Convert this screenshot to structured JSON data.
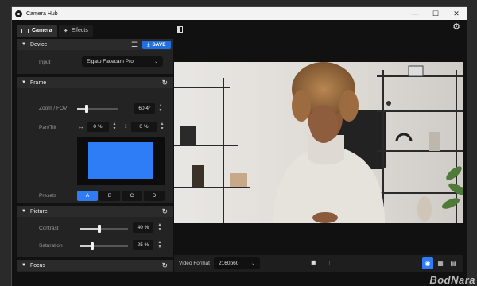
{
  "window": {
    "title": "Camera Hub"
  },
  "tabs": [
    {
      "label": "Camera",
      "icon": "camera-icon"
    },
    {
      "label": "Effects",
      "icon": "magic-wand-icon"
    }
  ],
  "device": {
    "section_title": "Device",
    "save_label": "SAVE",
    "input_label": "Input",
    "input_value": "Elgato Facecam Pro"
  },
  "frame": {
    "section_title": "Frame",
    "zoom_label": "Zoom / FOV",
    "zoom_value": "60.4°",
    "zoom_level": 0.23,
    "pantilt_label": "Pan/Tilt",
    "pan_value": "0 %",
    "tilt_value": "0 %",
    "presets_label": "Presets",
    "presets": [
      "A",
      "B",
      "C",
      "D"
    ],
    "active_preset": "A"
  },
  "picture": {
    "section_title": "Picture",
    "contrast_label": "Contrast",
    "contrast_value": "40 %",
    "contrast_level": 0.4,
    "saturation_label": "Saturation",
    "saturation_value": "25 %",
    "saturation_level": 0.25
  },
  "focus": {
    "section_title": "Focus"
  },
  "video_format": {
    "label": "Video Format",
    "value": "2160p60"
  },
  "watermark": "BodNara",
  "colors": {
    "accent": "#2f7df6",
    "save_button": "#1f6fe5",
    "panel": "#232323",
    "background": "#111111"
  }
}
